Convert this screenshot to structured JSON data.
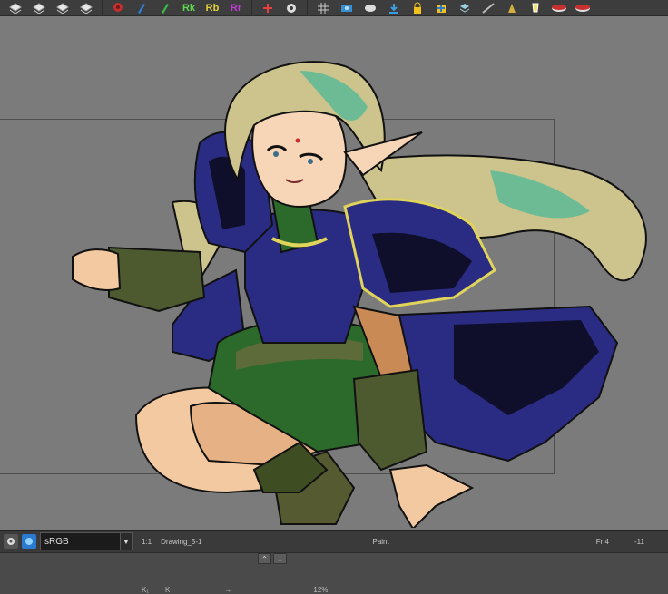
{
  "toolbar": {
    "groups": [
      {
        "name": "layer-tools",
        "items": [
          "layers-icon-1",
          "layers-icon-2",
          "layers-icon-3",
          "layers-icon-4"
        ]
      },
      {
        "name": "color-tools",
        "items": [
          "paint-icon",
          "brush-icon",
          "pencil-icon",
          "rk-label",
          "rb-label",
          "rr-label"
        ],
        "labels": {
          "rk": "Rk",
          "rb": "Rb",
          "rr": "Rr"
        }
      },
      {
        "name": "transform-tools",
        "items": [
          "add-icon",
          "gear-icon"
        ]
      },
      {
        "name": "view-tools",
        "items": [
          "grid-icon",
          "frame-icon",
          "onion-icon",
          "import-icon",
          "lock-icon",
          "add-drawing-icon",
          "stack-icon",
          "ruler-icon",
          "pen-icon",
          "highlight-icon",
          "disk-icon-1",
          "disk-icon-2"
        ]
      }
    ]
  },
  "colors": {
    "toolbar_bg": "#3d3d3d",
    "canvas_bg": "#7b7b7b",
    "rk": "#5fd84f",
    "rb": "#e0d23a",
    "rr": "#c23bd6"
  },
  "statusbar": {
    "color_space": "sRGB",
    "zoom": "1:1",
    "drawing_name": "Drawing_5-1",
    "mode": "Paint",
    "frame": "Fr 4",
    "extra": "-11"
  },
  "bottom": {
    "splitter_up": "⌃",
    "splitter_down": "⌄",
    "labels": [
      "K₁",
      "K",
      "→",
      "12%"
    ]
  }
}
